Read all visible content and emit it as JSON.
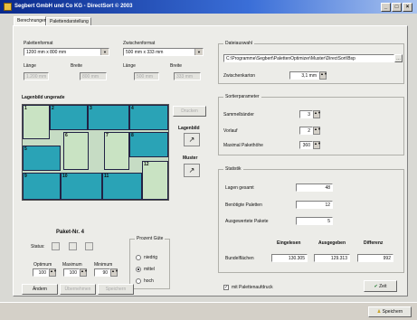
{
  "window": {
    "title": "Segbert GmbH und Co KG - DirectSort © 2003"
  },
  "tabs": [
    "Berechnungen",
    "Palettendarstellung"
  ],
  "palette_format": {
    "label": "Palettenformat",
    "value": "1200 mm x 800 mm",
    "laenge_label": "Länge",
    "breite_label": "Breite",
    "laenge": "1.200 mm",
    "breite": "800 mm"
  },
  "zwischen_format": {
    "label": "Zwischenformat",
    "value": "500 mm x 333 mm",
    "laenge_label": "Länge",
    "breite_label": "Breite",
    "laenge": "500 mm",
    "breite": "333 mm"
  },
  "layer_view": {
    "title": "Lagenbild   ungerade",
    "button": "Drucken"
  },
  "lagenbild": {
    "label": "Lagenbild"
  },
  "muster": {
    "label": "Muster"
  },
  "pieces": [
    "1",
    "2",
    "3",
    "4",
    "5",
    "6",
    "7",
    "8",
    "9",
    "10",
    "11",
    "12"
  ],
  "paket": {
    "title": "Paket-Nr. 4",
    "status_label": "Status:",
    "optimum_label": "Optimum",
    "maximum_label": "Maximum",
    "minimum_label": "Minimum",
    "optimum": "100",
    "maximum": "100",
    "minimum": "90"
  },
  "prozent": {
    "title": "Prozent Güte",
    "options": [
      "niedrig",
      "mittel",
      "hoch"
    ],
    "selected": "mittel"
  },
  "bottom_buttons": [
    "Ändern",
    "Übernehmen",
    "Speichern"
  ],
  "datei": {
    "title": "Dateiauswahl",
    "path": "C:\\Programme\\Segbert\\PalettenOptimizer\\Muster\\DirectSort\\Bsp",
    "zwischen_label": "Zwischenkarton",
    "zwischen_value": "3,1 mm"
  },
  "sortier": {
    "title": "Sortierparameter",
    "rows": [
      {
        "label": "Sammelbänder",
        "value": "3"
      },
      {
        "label": "Vorlauf",
        "value": "2"
      },
      {
        "label": "Maximal Pakethöhe",
        "value": "360"
      }
    ]
  },
  "statistik": {
    "title": "Statistik",
    "rows": [
      {
        "label": "Lagen gesamt",
        "value": "48"
      },
      {
        "label": "Benötigte Paletten",
        "value": "12"
      },
      {
        "label": "Ausgewertete Pakete",
        "value": "5"
      }
    ],
    "cols": [
      "Eingelesen",
      "Ausgegeben",
      "Differenz"
    ],
    "bundel_label": "Bundelflächen",
    "bundel_values": [
      "130.305",
      "129.313",
      "992"
    ]
  },
  "checkbox": {
    "label": "mit Palettenaufdruck",
    "checked": true
  },
  "ok_button": "Zeit",
  "status": {
    "button": "Speichern",
    "accent": "#2aa3b6"
  }
}
